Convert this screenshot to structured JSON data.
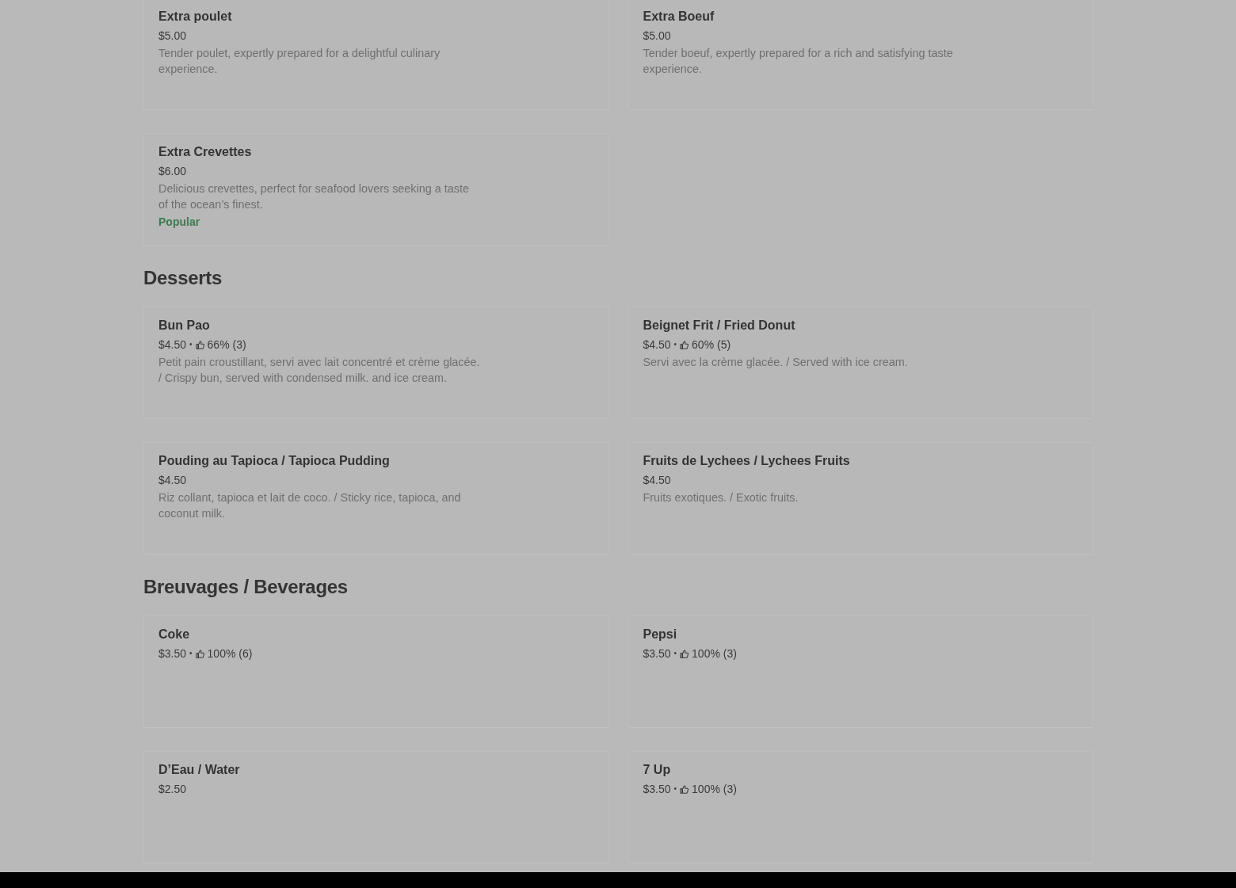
{
  "sections": [
    {
      "items": [
        {
          "name": "Extra poulet",
          "price": "$5.00",
          "description": "Tender poulet, expertly prepared for a delightful culinary experience."
        },
        {
          "name": "Extra Boeuf",
          "price": "$5.00",
          "description": "Tender boeuf, expertly prepared for a rich and satisfying taste experience."
        },
        {
          "name": "Extra Crevettes",
          "price": "$6.00",
          "description": "Delicious crevettes, perfect for seafood lovers seeking a taste of the ocean’s finest.",
          "tag": "Popular"
        }
      ]
    },
    {
      "heading": "Desserts",
      "items": [
        {
          "name": "Bun Pao",
          "price": "$4.50",
          "separator": "•",
          "rating": "66% (3)",
          "description": "Petit pain croustillant, servi avec lait concentré et crème glacée. / Crispy bun, served with condensed milk. and ice cream."
        },
        {
          "name": "Beignet Frit / Fried Donut",
          "price": "$4.50",
          "separator": "•",
          "rating": "60% (5)",
          "description": "Servi avec la crème glacée. / Served with ice cream."
        },
        {
          "name": "Pouding au Tapioca / Tapioca Pudding",
          "price": "$4.50",
          "description": "Riz collant, tapioca et lait de coco. / Sticky rice, tapioca, and coconut milk."
        },
        {
          "name": "Fruits de Lychees / Lychees Fruits",
          "price": "$4.50",
          "description": "Fruits exotiques. / Exotic fruits."
        }
      ]
    },
    {
      "heading": "Breuvages / Beverages",
      "items": [
        {
          "name": "Coke",
          "price": "$3.50",
          "separator": "•",
          "rating": "100% (6)"
        },
        {
          "name": "Pepsi",
          "price": "$3.50",
          "separator": "•",
          "rating": "100% (3)"
        },
        {
          "name": "D’Eau / Water",
          "price": "$2.50"
        },
        {
          "name": "7 Up",
          "price": "$3.50",
          "separator": "•",
          "rating": "100% (3)"
        }
      ]
    }
  ]
}
